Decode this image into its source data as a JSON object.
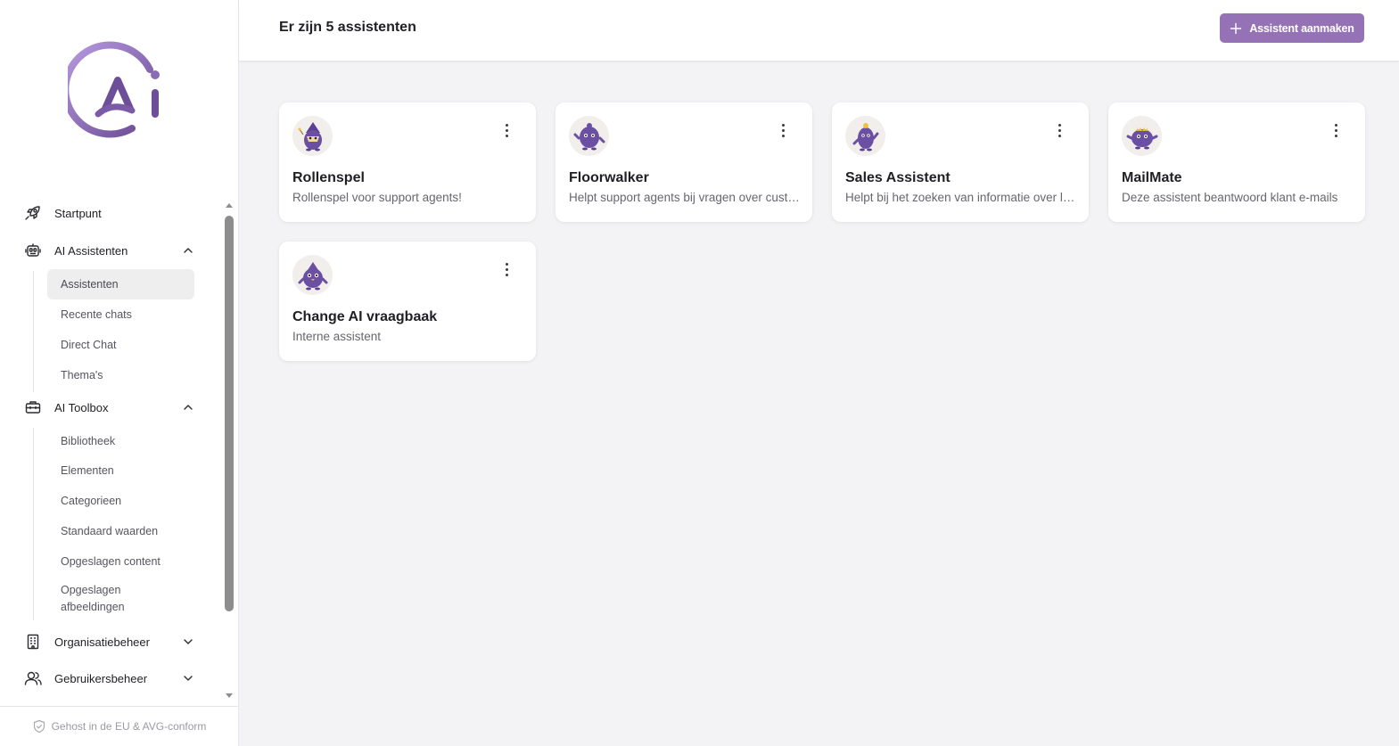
{
  "sidebar": {
    "logo_alt": "Change AI logo",
    "nav": {
      "startpunt": "Startpunt",
      "ai_assistenten": "AI Assistenten",
      "ai_assistenten_items": [
        "Assistenten",
        "Recente chats",
        "Direct Chat",
        "Thema's"
      ],
      "ai_toolbox": "AI Toolbox",
      "ai_toolbox_items": [
        "Bibliotheek",
        "Elementen",
        "Categorieen",
        "Standaard waarden",
        "Opgeslagen content",
        "Opgeslagen afbeeldingen"
      ],
      "organisatiebeheer": "Organisatiebeheer",
      "gebruikersbeheer": "Gebruikersbeheer"
    },
    "active_item": "Assistenten",
    "footer": "Gehost in de EU & AVG-conform"
  },
  "header": {
    "title": "Er zijn 5 assistenten",
    "create_button": "Assistent aanmaken"
  },
  "assistants": [
    {
      "name": "Rollenspel",
      "description": "Rollenspel voor support agents!",
      "avatar": "wizard-mascot-icon"
    },
    {
      "name": "Floorwalker",
      "description": "Helpt support agents bij vragen over customers",
      "avatar": "mascot-icon"
    },
    {
      "name": "Sales Assistent",
      "description": "Helpt bij het zoeken van informatie over leads",
      "avatar": "mascot-icon"
    },
    {
      "name": "MailMate",
      "description": "Deze assistent beantwoord klant e-mails",
      "avatar": "mascot-icon"
    },
    {
      "name": "Change AI vraagbaak",
      "description": "Interne assistent",
      "avatar": "mascot-icon"
    }
  ],
  "colors": {
    "accent": "#9572b5",
    "logo_gradient_start": "#a88ad0",
    "logo_gradient_end": "#6c4d95",
    "mascot": "#6a4fa3"
  }
}
